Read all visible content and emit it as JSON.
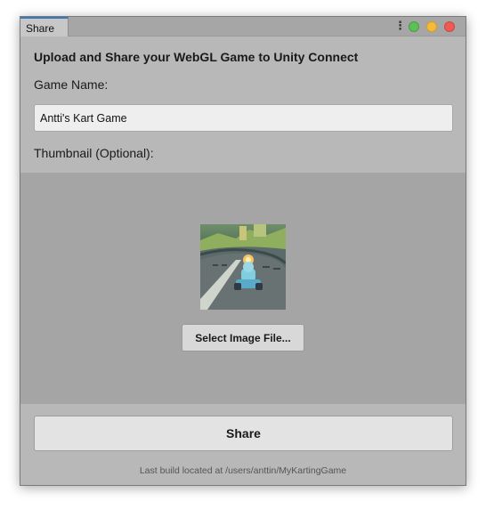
{
  "window": {
    "tab_label": "Share"
  },
  "colors": {
    "window_bg": "#b8b8b8",
    "thumbnail_area_bg": "#a5a5a5",
    "tab_accent": "#3a79bb",
    "close": "#ee5a55",
    "minimize": "#f4bb3b",
    "maximize": "#5fbf57"
  },
  "icons": [
    "kebab-menu-icon",
    "maximize-light-icon",
    "minimize-light-icon",
    "close-light-icon"
  ],
  "form": {
    "heading": "Upload and Share your WebGL Game to Unity Connect",
    "game_name_label": "Game Name:",
    "game_name_value": "Antti's Kart Game",
    "thumbnail_label": "Thumbnail (Optional):",
    "select_image_label": "Select Image File...",
    "share_label": "Share"
  },
  "footer": {
    "build_location": "Last build located at /users/anttin/MyKartingGame"
  }
}
